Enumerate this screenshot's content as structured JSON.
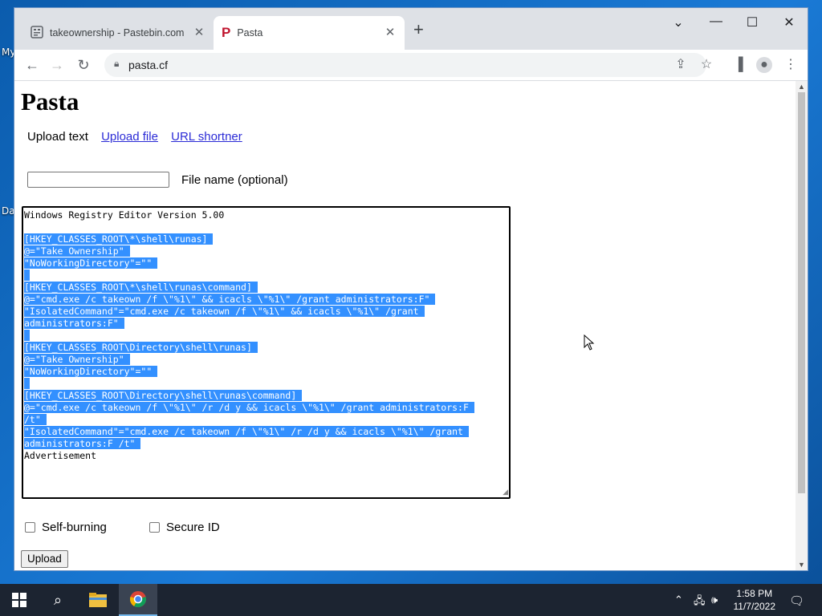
{
  "desktop": {
    "icon_labels": [
      "My",
      "Da"
    ]
  },
  "browser": {
    "tabs": [
      {
        "title": "takeownership - Pastebin.com",
        "icon": "pastebin-favicon"
      },
      {
        "title": "Pasta",
        "icon": "pasta-favicon",
        "favicon_letter": "P",
        "favicon_color": "#c0152f"
      }
    ],
    "tab_close_glyph": "✕",
    "new_tab_glyph": "+",
    "url": "pasta.cf"
  },
  "page": {
    "title": "Pasta",
    "nav": {
      "upload_text": "Upload text",
      "upload_file": "Upload file",
      "url_shortner": "URL shortner"
    },
    "file_name_label": "File name (optional)",
    "file_name_value": "",
    "textarea_lines": [
      {
        "text": "Windows Registry Editor Version 5.00",
        "selected": false
      },
      {
        "text": "",
        "selected": false
      },
      {
        "text": "[HKEY_CLASSES_ROOT\\*\\shell\\runas]",
        "selected": true
      },
      {
        "text": "@=\"Take Ownership\"",
        "selected": true
      },
      {
        "text": "\"NoWorkingDirectory\"=\"\"",
        "selected": true
      },
      {
        "text": "",
        "selected": true
      },
      {
        "text": "[HKEY_CLASSES_ROOT\\*\\shell\\runas\\command]",
        "selected": true
      },
      {
        "text": "@=\"cmd.exe /c takeown /f \\\"%1\\\" && icacls \\\"%1\\\" /grant administrators:F\"",
        "selected": true
      },
      {
        "text": "\"IsolatedCommand\"=\"cmd.exe /c takeown /f \\\"%1\\\" && icacls \\\"%1\\\" /grant",
        "selected": true
      },
      {
        "text": "administrators:F\"",
        "selected": true
      },
      {
        "text": "",
        "selected": true
      },
      {
        "text": "[HKEY_CLASSES_ROOT\\Directory\\shell\\runas]",
        "selected": true
      },
      {
        "text": "@=\"Take Ownership\"",
        "selected": true
      },
      {
        "text": "\"NoWorkingDirectory\"=\"\"",
        "selected": true
      },
      {
        "text": "",
        "selected": true
      },
      {
        "text": "[HKEY_CLASSES_ROOT\\Directory\\shell\\runas\\command]",
        "selected": true
      },
      {
        "text": "@=\"cmd.exe /c takeown /f \\\"%1\\\" /r /d y && icacls \\\"%1\\\" /grant administrators:F",
        "selected": true
      },
      {
        "text": "/t\"",
        "selected": true
      },
      {
        "text": "\"IsolatedCommand\"=\"cmd.exe /c takeown /f \\\"%1\\\" /r /d y && icacls \\\"%1\\\" /grant",
        "selected": true
      },
      {
        "text": "administrators:F /t\"",
        "selected": true
      },
      {
        "text": "Advertisement",
        "selected": false
      }
    ],
    "selection_color": "#3390ff",
    "checkbox_self_burning": {
      "label": "Self-burning",
      "checked": false
    },
    "checkbox_secure_id": {
      "label": "Secure ID",
      "checked": false
    },
    "upload_button": "Upload"
  },
  "taskbar": {
    "time": "1:58 PM",
    "date": "11/7/2022"
  }
}
